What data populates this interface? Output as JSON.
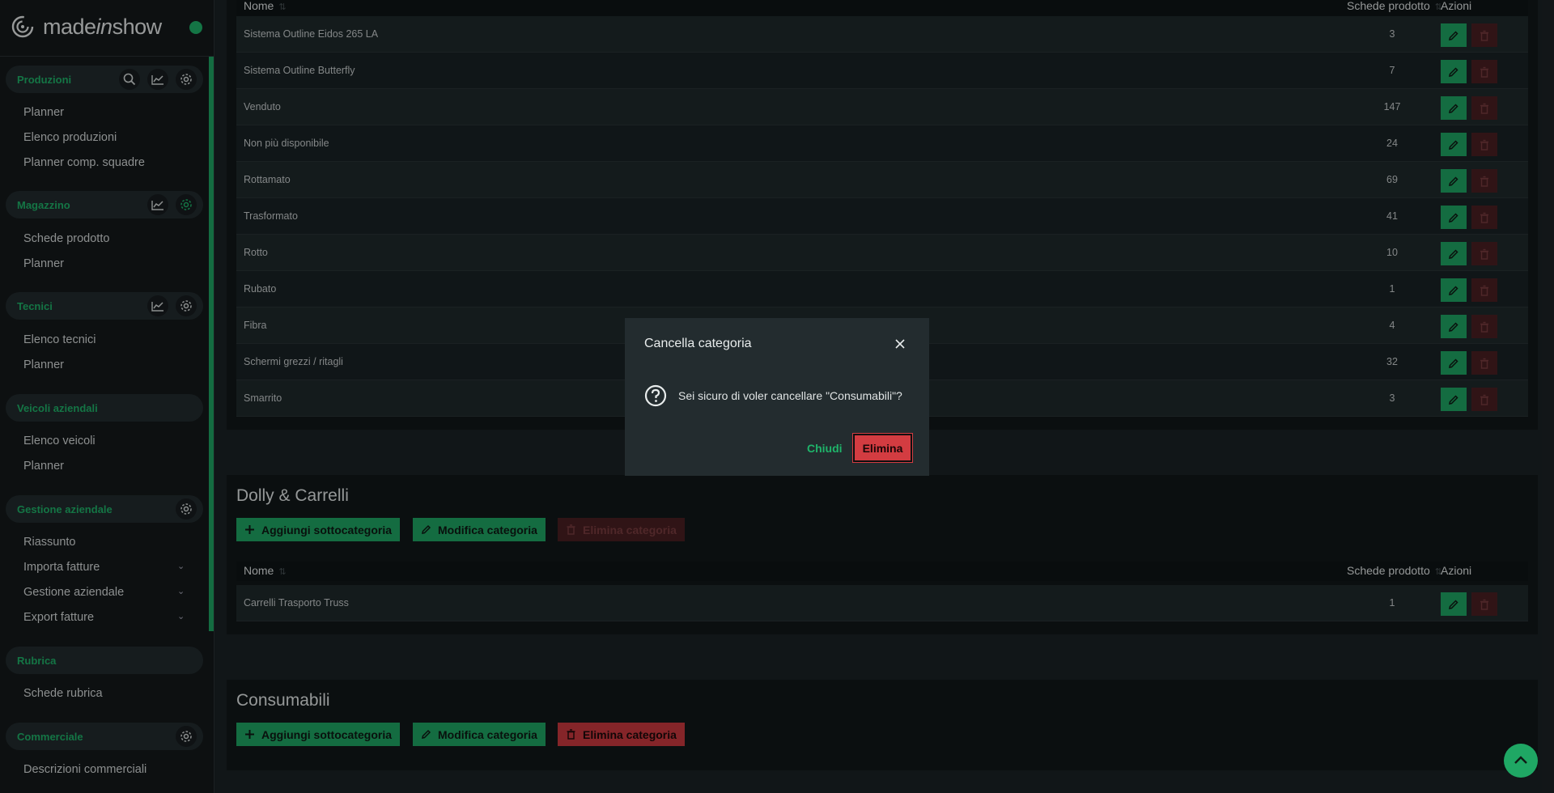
{
  "brand": {
    "name_pre": "made",
    "name_mid": "in",
    "name_post": "show"
  },
  "sidebar": {
    "sections": [
      {
        "label": "Produzioni",
        "icons": [
          "search-icon",
          "chart-icon",
          "gear-icon"
        ],
        "items": [
          {
            "label": "Planner"
          },
          {
            "label": "Elenco produzioni"
          },
          {
            "label": "Planner comp. squadre"
          }
        ]
      },
      {
        "label": "Magazzino",
        "icons": [
          "chart-icon",
          "gear-icon"
        ],
        "items": [
          {
            "label": "Schede prodotto"
          },
          {
            "label": "Planner"
          }
        ]
      },
      {
        "label": "Tecnici",
        "icons": [
          "chart-icon",
          "gear-icon"
        ],
        "items": [
          {
            "label": "Elenco tecnici"
          },
          {
            "label": "Planner"
          }
        ]
      },
      {
        "label": "Veicoli aziendali",
        "icons": [],
        "items": [
          {
            "label": "Elenco veicoli"
          },
          {
            "label": "Planner"
          }
        ]
      },
      {
        "label": "Gestione aziendale",
        "icons": [
          "gear-icon"
        ],
        "items": [
          {
            "label": "Riassunto"
          },
          {
            "label": "Importa fatture",
            "expandable": true
          },
          {
            "label": "Gestione aziendale",
            "expandable": true
          },
          {
            "label": "Export fatture",
            "expandable": true
          }
        ]
      },
      {
        "label": "Rubrica",
        "icons": [],
        "items": [
          {
            "label": "Schede rubrica"
          }
        ]
      },
      {
        "label": "Commerciale",
        "icons": [
          "gear-icon"
        ],
        "items": [
          {
            "label": "Descrizioni commerciali"
          }
        ]
      }
    ]
  },
  "table_headers": {
    "name": "Nome",
    "count": "Schede prodotto",
    "actions": "Azioni"
  },
  "top_table": {
    "rows": [
      {
        "name": "Sistema Outline Eidos 265 LA",
        "count": "3"
      },
      {
        "name": "Sistema Outline Butterfly",
        "count": "7"
      },
      {
        "name": "Venduto",
        "count": "147"
      },
      {
        "name": "Non più disponibile",
        "count": "24"
      },
      {
        "name": "Rottamato",
        "count": "69"
      },
      {
        "name": "Trasformato",
        "count": "41"
      },
      {
        "name": "Rotto",
        "count": "10"
      },
      {
        "name": "Rubato",
        "count": "1"
      },
      {
        "name": "Fibra",
        "count": "4"
      },
      {
        "name": "Schermi grezzi / ritagli",
        "count": "32"
      },
      {
        "name": "Smarrito",
        "count": "3"
      }
    ]
  },
  "categories": [
    {
      "title": "Dolly & Carrelli",
      "add_label": "Aggiungi sottocategoria",
      "edit_label": "Modifica categoria",
      "delete_label": "Elimina categoria",
      "delete_enabled": false,
      "rows": [
        {
          "name": "Carrelli Trasporto Truss",
          "count": "1"
        }
      ]
    },
    {
      "title": "Consumabili",
      "add_label": "Aggiungi sottocategoria",
      "edit_label": "Modifica categoria",
      "delete_label": "Elimina categoria",
      "delete_enabled": true
    }
  ],
  "modal": {
    "title": "Cancella categoria",
    "message": "Sei sicuro di voler cancellare \"Consumabili\"?",
    "close_label": "Chiudi",
    "confirm_label": "Elimina"
  },
  "colors": {
    "accent": "#1fa764",
    "danger": "#d33c41",
    "background": "#1b2225"
  }
}
